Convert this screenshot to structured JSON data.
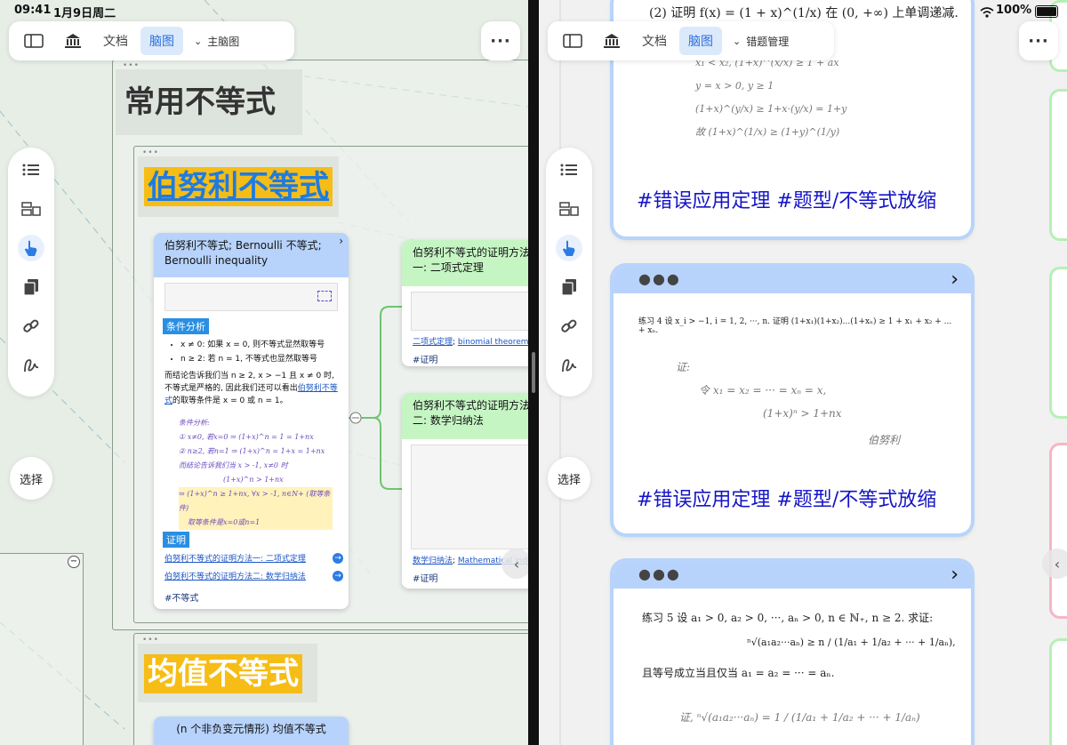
{
  "status": {
    "time": "09:41",
    "date": "1月9日周二",
    "battery": "100%"
  },
  "left": {
    "toolbar": {
      "doc": "文档",
      "mindmap": "脑图",
      "dropdown": "主脑图"
    },
    "select_label": "选择",
    "frame_title": "常用不等式",
    "section1_title": "伯努利不等式",
    "section2_title": "均值不等式",
    "main_card": {
      "title": "伯努利不等式; Bernoulli 不等式; Bernoulli inequality",
      "cond_label": "条件分析",
      "bullet1": "x ≠ 0: 如果 x = 0, 则不等式显然取等号",
      "bullet2": "n ≥ 2: 若 n = 1, 不等式也显然取等号",
      "para": "而结论告诉我们当 n ≥ 2, x > −1 且 x ≠ 0 时, 不等式是严格的, 因此我们还可以看出",
      "para_link": "伯努利不等式",
      "para_tail": "的取等条件是 x = 0 或 n = 1。",
      "proof_label": "证明",
      "link1": "伯努利不等式的证明方法一: 二项式定理",
      "link2": "伯努利不等式的证明方法二: 数学归纳法",
      "tag": "#不等式"
    },
    "card2": {
      "title": "伯努利不等式的证明方法一: 二项式定理",
      "link_a": "二项式定理",
      "link_b": "binomial theorem",
      "tag": "#证明"
    },
    "card3": {
      "title": "伯努利不等式的证明方法二: 数学归纳法",
      "link_a": "数学归纳法",
      "link_b": "Mathematical induction",
      "tag": "#证明"
    },
    "card4": {
      "title": "(n 个非负变元情形) 均值不等式"
    },
    "handwriting": [
      "条件分析:",
      "① x≠0, 若x=0 ⇒ (1+x)^n = 1 = 1+nx",
      "② n≥2, 若n=1 ⇒ (1+x)^n = 1+x = 1+nx",
      "而结论告诉我们当 x > -1, x≠0 时",
      "(1+x)^n > 1+nx",
      "⇒ (1+x)^n ≥ 1+nx, ∀x > -1, n∈N+ (取等条件)",
      "取等条件是x=0或n=1"
    ]
  },
  "right": {
    "toolbar": {
      "doc": "文档",
      "mindmap": "脑图",
      "dropdown": "错题管理"
    },
    "select_label": "选择",
    "card1": {
      "text": "(2) 证明 f(x) = (1 + x)^(1/x) 在 (0, +∞) 上单调递减.",
      "hand": [
        "x₁ < x₂, (1+x)^(x/x) ≥ 1 + ax",
        "y = x > 0, y ≥ 1",
        "(1+x)^(y/x) ≥ 1+x·(y/x) = 1+y",
        "故 (1+x)^(1/x) ≥ (1+y)^(1/y)"
      ],
      "tag": "#错误应用定理 #题型/不等式放缩"
    },
    "card2": {
      "text": "练习 4 设 x_i > −1, i = 1, 2, ···, n. 证明 (1+x₁)(1+x₂)...(1+xₙ) ≥ 1 + x₁ + x₂ + ... + xₙ.",
      "hand": [
        "证:",
        "令 x₁ = x₂ = ··· = xₙ = x,",
        "(1+x)ⁿ > 1+nx",
        "伯努利"
      ],
      "tag": "#错误应用定理 #题型/不等式放缩"
    },
    "card3": {
      "text": "练习 5 设 a₁ > 0, a₂ > 0, ···, aₙ > 0, n ∈ ℕ₊, n ≥ 2. 求证:",
      "formula": "ⁿ√(a₁a₂···aₙ) ≥ n / (1/a₁ + 1/a₂ + ··· + 1/aₙ),",
      "text2": "且等号成立当且仅当 a₁ = a₂ = ··· = aₙ.",
      "hand": "证,  ⁿ√(a₁a₂···aₙ) = 1 / (1/a₁ + 1/a₂ + ··· + 1/aₙ)"
    }
  }
}
